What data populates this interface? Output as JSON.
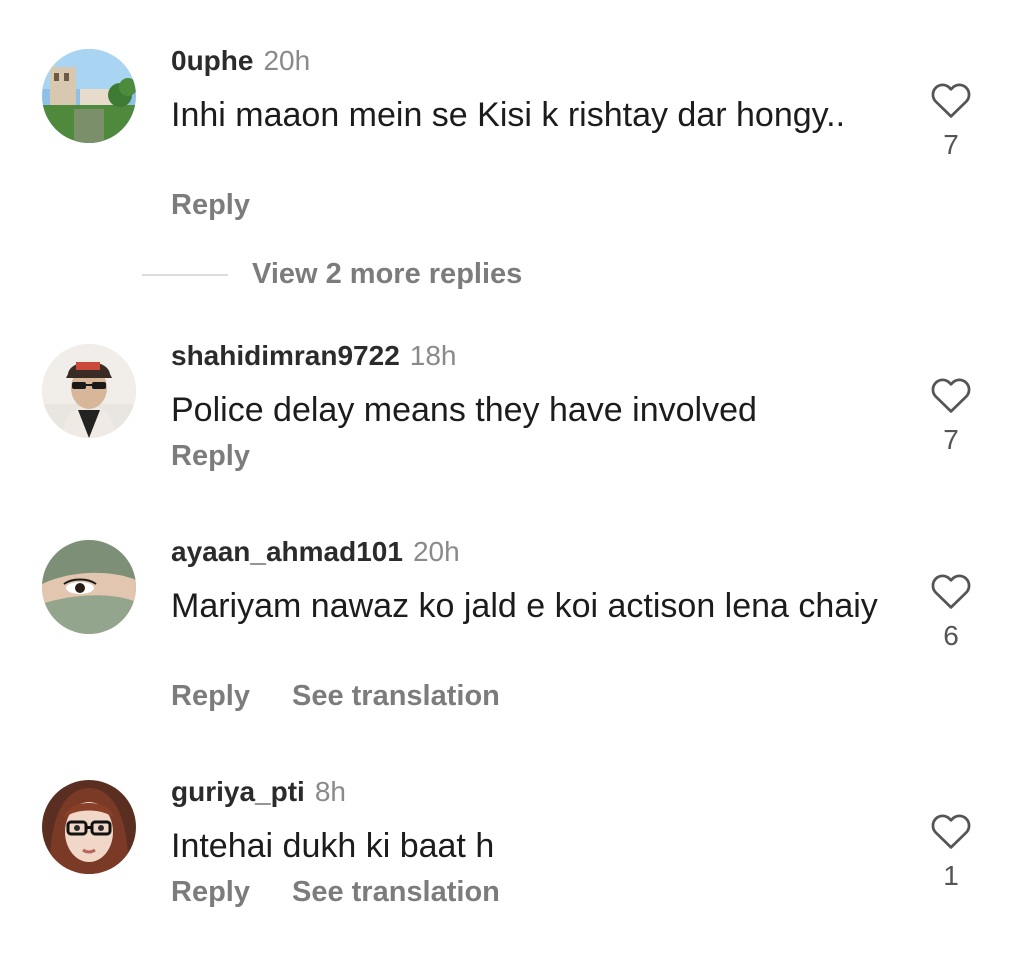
{
  "comments": [
    {
      "username": "0uphe",
      "time": "20h",
      "text": "Inhi maaon mein se Kisi k rishtay dar hongy..",
      "reply_label": "Reply",
      "likes": "7",
      "avatar": "building-garden-avatar"
    },
    {
      "username": "shahidimran9722",
      "time": "18h",
      "text": "Police  delay means they have involved",
      "reply_label": "Reply",
      "likes": "7",
      "avatar": "man-cap-sunglasses-avatar"
    },
    {
      "username": "ayaan_ahmad101",
      "time": "20h",
      "text": "Mariyam nawaz ko jald e koi actison lena chaiy",
      "reply_label": "Reply",
      "translate_label": "See translation",
      "likes": "6",
      "avatar": "veiled-eyes-avatar"
    },
    {
      "username": "guriya_pti",
      "time": "8h",
      "text": "Intehai dukh ki baat h",
      "reply_label": "Reply",
      "translate_label": "See translation",
      "likes": "1",
      "avatar": "doll-glasses-avatar"
    }
  ],
  "view_more_replies": "View 2 more replies",
  "colors": {
    "username": "#2b2b2b",
    "secondary": "#7c7c7c",
    "timestamp": "#8a8a8a",
    "body_text": "#1c1c1c",
    "divider": "#dcdcdc"
  },
  "icons": {
    "like": "heart-outline-icon"
  }
}
